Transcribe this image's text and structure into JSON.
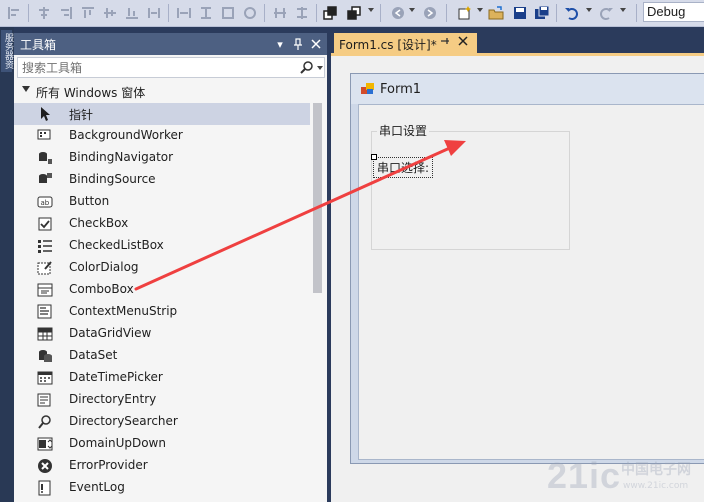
{
  "toolbar": {
    "configuration_value": "Debug",
    "icons": [
      "align-lefts-icon",
      "align-centers-icon",
      "align-rights-icon",
      "align-tops-icon",
      "align-middles-icon",
      "align-bottoms-icon",
      "make-same-width-icon",
      "make-same-height-icon",
      "size-to-grid-icon",
      "make-same-size-icon",
      "align-to-grid-icon",
      "horizontal-spacing-icon",
      "vertical-spacing-icon",
      "bring-to-front-icon",
      "send-to-back-icon",
      "navigate-back-icon",
      "navigate-forward-icon",
      "new-project-icon",
      "open-file-icon",
      "save-icon",
      "save-all-icon",
      "undo-icon",
      "redo-icon"
    ]
  },
  "side_strip": {
    "tab_label": "服务器资"
  },
  "toolbox": {
    "title": "工具箱",
    "search_placeholder": "搜索工具箱",
    "group_label": "所有 Windows 窗体",
    "items": [
      {
        "label": "指针",
        "icon": "pointer-icon"
      },
      {
        "label": "BackgroundWorker",
        "icon": "background-worker-icon"
      },
      {
        "label": "BindingNavigator",
        "icon": "binding-navigator-icon"
      },
      {
        "label": "BindingSource",
        "icon": "binding-source-icon"
      },
      {
        "label": "Button",
        "icon": "button-icon"
      },
      {
        "label": "CheckBox",
        "icon": "checkbox-icon"
      },
      {
        "label": "CheckedListBox",
        "icon": "checked-list-box-icon"
      },
      {
        "label": "ColorDialog",
        "icon": "color-dialog-icon"
      },
      {
        "label": "ComboBox",
        "icon": "combobox-icon"
      },
      {
        "label": "ContextMenuStrip",
        "icon": "context-menu-strip-icon"
      },
      {
        "label": "DataGridView",
        "icon": "data-grid-view-icon"
      },
      {
        "label": "DataSet",
        "icon": "dataset-icon"
      },
      {
        "label": "DateTimePicker",
        "icon": "date-time-picker-icon"
      },
      {
        "label": "DirectoryEntry",
        "icon": "directory-entry-icon"
      },
      {
        "label": "DirectorySearcher",
        "icon": "directory-searcher-icon"
      },
      {
        "label": "DomainUpDown",
        "icon": "domain-up-down-icon"
      },
      {
        "label": "ErrorProvider",
        "icon": "error-provider-icon"
      },
      {
        "label": "EventLog",
        "icon": "event-log-icon"
      }
    ]
  },
  "document": {
    "tab_label": "Form1.cs [设计]*",
    "form_title": "Form1",
    "groupbox_label": "串口设置",
    "label_text": "串口选择:"
  },
  "colors": {
    "ide_background": "#2b3b5c",
    "panel_header": "#4d6082",
    "active_tab": "#f5cc84",
    "selected_item": "#cdd3e3",
    "annotation_arrow": "#ef4040"
  },
  "watermark": {
    "brand": "21ic",
    "sub": "中国电子网",
    "url": "www.21ic.com"
  }
}
